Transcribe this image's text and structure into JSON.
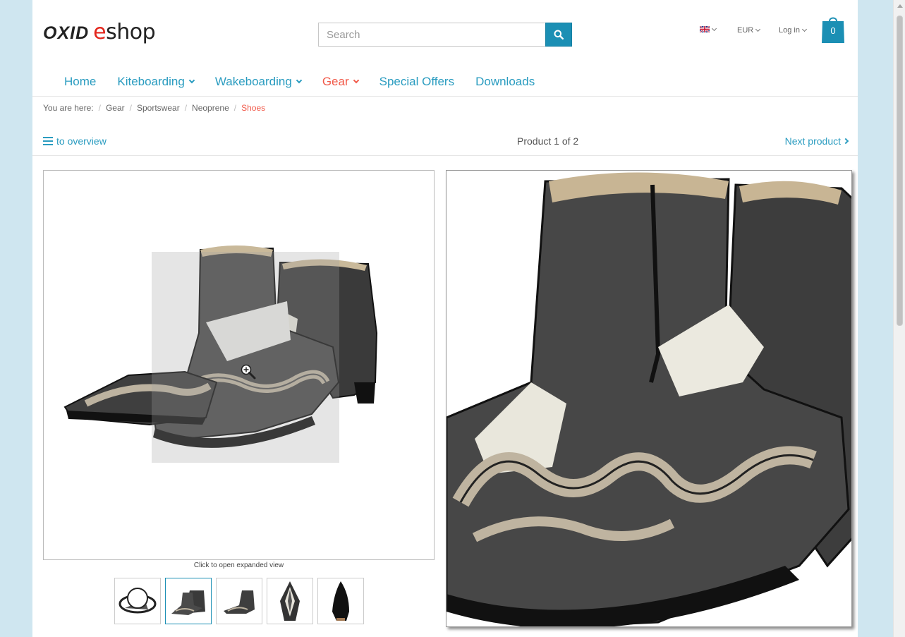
{
  "header": {
    "logo_part1": "OXID",
    "logo_e": "e",
    "logo_part2": "shop",
    "search_placeholder": "Search",
    "currency": "EUR",
    "login": "Log in",
    "cart_count": "0",
    "language_flag": "uk-flag-icon",
    "brand_color": "#1b8fb4",
    "accent_color": "#f15a4a"
  },
  "nav": {
    "items": [
      {
        "label": "Home",
        "dropdown": false,
        "active": false
      },
      {
        "label": "Kiteboarding",
        "dropdown": true,
        "active": false
      },
      {
        "label": "Wakeboarding",
        "dropdown": true,
        "active": false
      },
      {
        "label": "Gear",
        "dropdown": true,
        "active": true
      },
      {
        "label": "Special Offers",
        "dropdown": false,
        "active": false
      },
      {
        "label": "Downloads",
        "dropdown": false,
        "active": false
      }
    ]
  },
  "breadcrumb": {
    "prefix": "You are here:",
    "items": [
      "Gear",
      "Sportswear",
      "Neoprene"
    ],
    "current": "Shoes"
  },
  "product_nav": {
    "overview": "to overview",
    "count": "Product 1 of 2",
    "next": "Next product"
  },
  "gallery": {
    "caption": "Click to open expanded view",
    "thumbnails": [
      {
        "name": "360-view",
        "active": false
      },
      {
        "name": "boots-pair",
        "active": true
      },
      {
        "name": "boot-side",
        "active": false
      },
      {
        "name": "boot-top",
        "active": false
      },
      {
        "name": "boot-sole",
        "active": false
      }
    ]
  }
}
